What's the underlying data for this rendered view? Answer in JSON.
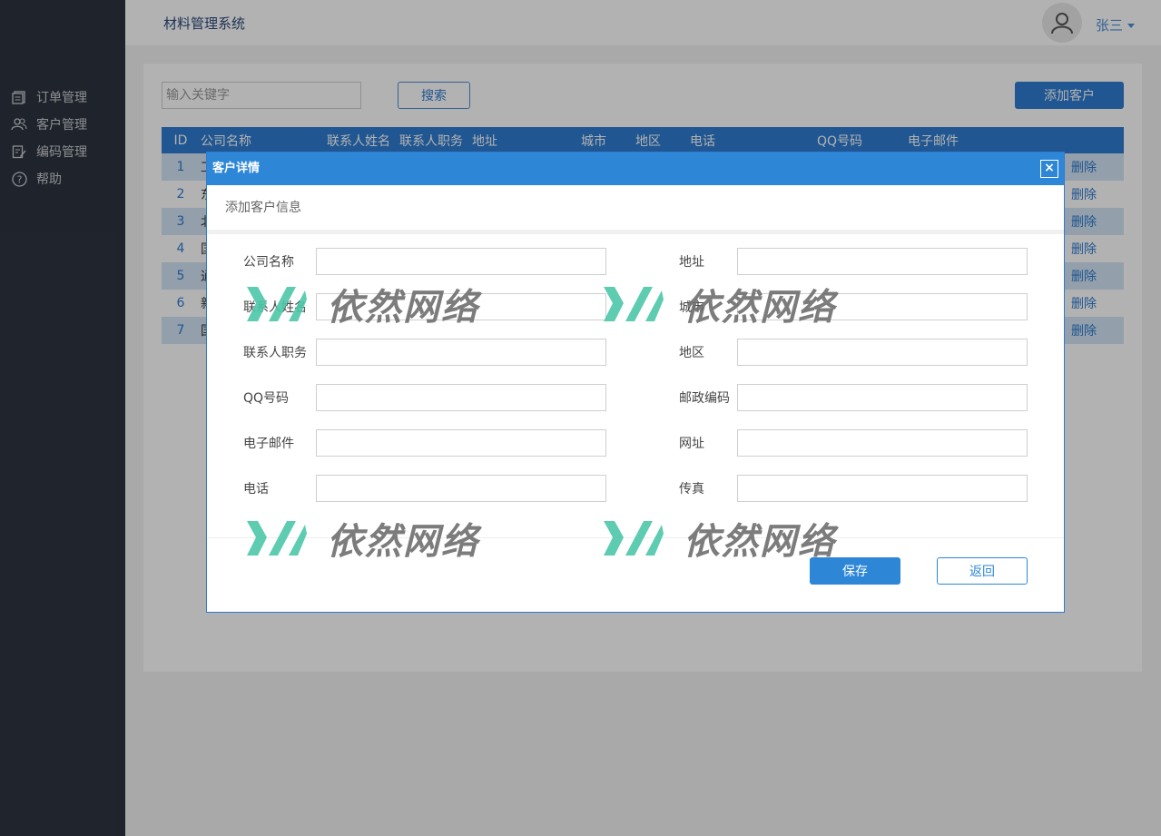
{
  "header": {
    "app_title": "材料管理系统",
    "username": "张三"
  },
  "sidebar": {
    "items": [
      {
        "label": "订单管理",
        "icon": "order-icon"
      },
      {
        "label": "客户管理",
        "icon": "users-icon"
      },
      {
        "label": "编码管理",
        "icon": "edit-icon"
      },
      {
        "label": "帮助",
        "icon": "help-icon"
      }
    ]
  },
  "toolbar": {
    "search_placeholder": "输入关键字",
    "search_label": "搜索",
    "add_label": "添加客户"
  },
  "table": {
    "columns": [
      "ID",
      "公司名称",
      "联系人姓名",
      "联系人职务",
      "地址",
      "城市",
      "地区",
      "电话",
      "QQ号码",
      "电子邮件"
    ],
    "rows": [
      {
        "id": "1",
        "company": "工",
        "action": "删除"
      },
      {
        "id": "2",
        "company": "东",
        "action": "删除"
      },
      {
        "id": "3",
        "company": "北",
        "action": "删除"
      },
      {
        "id": "4",
        "company": "国",
        "action": "删除"
      },
      {
        "id": "5",
        "company": "通",
        "action": "删除"
      },
      {
        "id": "6",
        "company": "新",
        "action": "删除"
      },
      {
        "id": "7",
        "company": "国",
        "action": "删除"
      }
    ]
  },
  "modal": {
    "title": "客户详情",
    "close": "×",
    "subtitle": "添加客户信息",
    "fields_left": [
      "公司名称",
      "联系人姓名",
      "联系人职务",
      "QQ号码",
      "电子邮件",
      "电话"
    ],
    "fields_right": [
      "地址",
      "城市",
      "地区",
      "邮政编码",
      "网址",
      "传真"
    ],
    "save_label": "保存",
    "back_label": "返回"
  },
  "watermark": {
    "text": "依然网络"
  },
  "colors": {
    "sidebar": "#2d3440",
    "accent": "#2e7bd0",
    "modal_header": "#2e87d6",
    "row_alt": "#d3e4f5",
    "watermark_green": "#4cc7a8"
  }
}
